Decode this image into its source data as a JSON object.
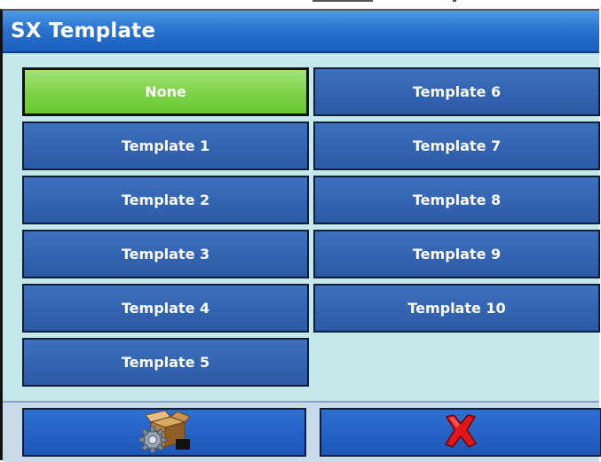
{
  "window": {
    "title": "SX Template"
  },
  "templates": {
    "left": [
      {
        "label": "None",
        "selected": true
      },
      {
        "label": "Template 1"
      },
      {
        "label": "Template 2"
      },
      {
        "label": "Template 3"
      },
      {
        "label": "Template 4"
      },
      {
        "label": "Template 5"
      }
    ],
    "right": [
      {
        "label": "Template 6"
      },
      {
        "label": "Template 7"
      },
      {
        "label": "Template 8"
      },
      {
        "label": "Template 9"
      },
      {
        "label": "Template 10"
      }
    ]
  },
  "footer": {
    "confirm_icon": "box-with-gear-icon",
    "cancel_icon": "red-x-icon"
  },
  "colors": {
    "button_blue": "#2b5aa6",
    "selected_green": "#7bd246",
    "title_blue": "#2a73cf",
    "panel": "#c5e8ea"
  }
}
